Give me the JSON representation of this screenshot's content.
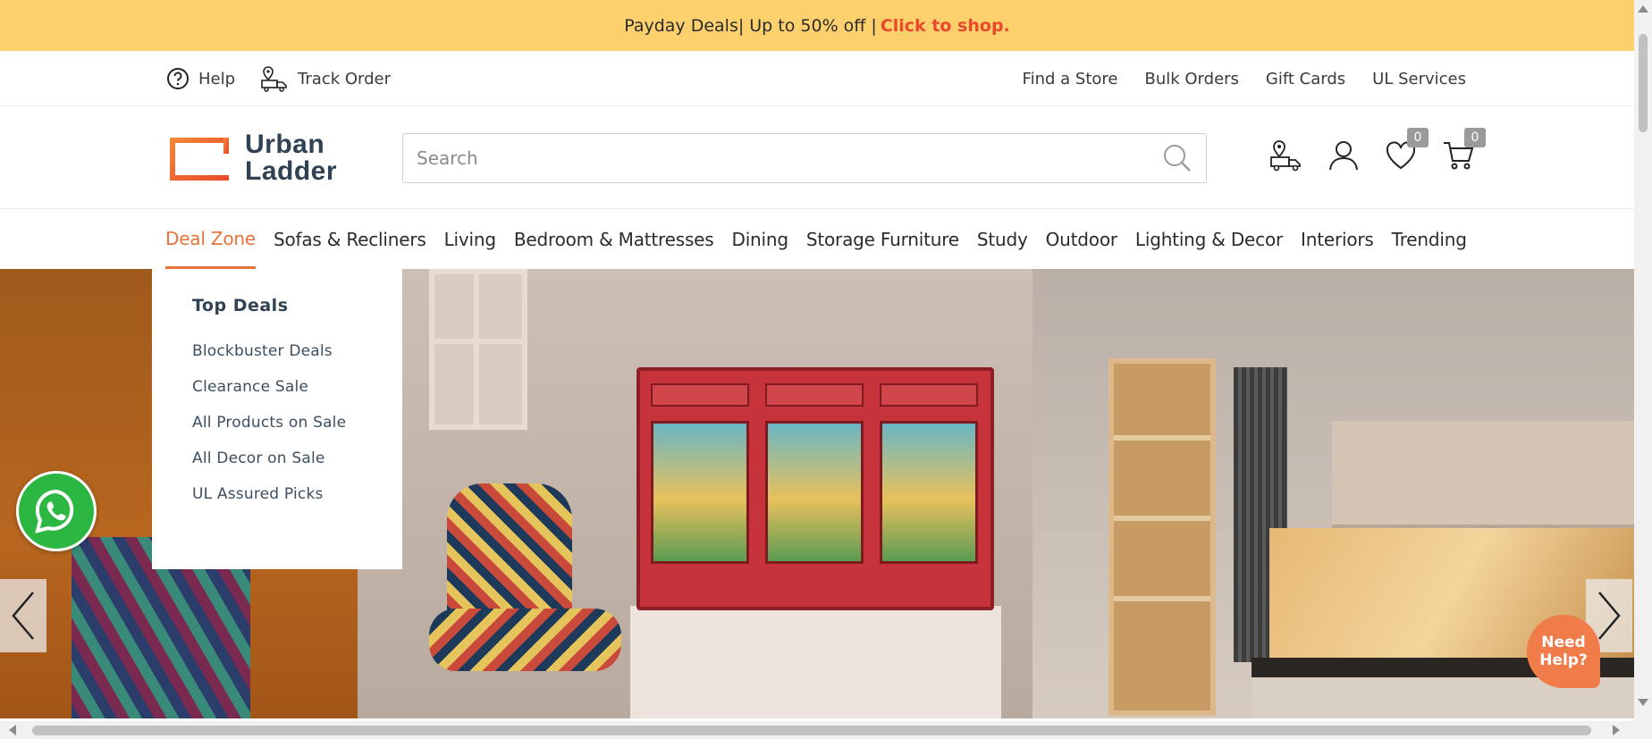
{
  "promo": {
    "text": "Payday Deals| Up to 50% off |",
    "cta": "Click to shop."
  },
  "utility": {
    "help": "Help",
    "track_order": "Track Order",
    "right_links": [
      "Find a Store",
      "Bulk Orders",
      "Gift Cards",
      "UL Services"
    ]
  },
  "header": {
    "logo_line1": "Urban",
    "logo_line2": "Ladder",
    "search_placeholder": "Search",
    "wishlist_count": "0",
    "cart_count": "0"
  },
  "nav": {
    "items": [
      "Deal Zone",
      "Sofas & Recliners",
      "Living",
      "Bedroom & Mattresses",
      "Dining",
      "Storage Furniture",
      "Study",
      "Outdoor",
      "Lighting & Decor",
      "Interiors",
      "Trending"
    ],
    "active": "Deal Zone"
  },
  "dropdown": {
    "title": "Top Deals",
    "items": [
      "Blockbuster Deals",
      "Clearance Sale",
      "All Products on Sale",
      "All Decor on Sale",
      "UL Assured Picks"
    ]
  },
  "help_bubble": {
    "line1": "Need",
    "line2": "Help?"
  },
  "colors": {
    "promo_bg": "#fdd06e",
    "accent": "#e8733a",
    "cta": "#e8492b",
    "whatsapp": "#2bb741",
    "help_bubble": "#f07c4a"
  }
}
